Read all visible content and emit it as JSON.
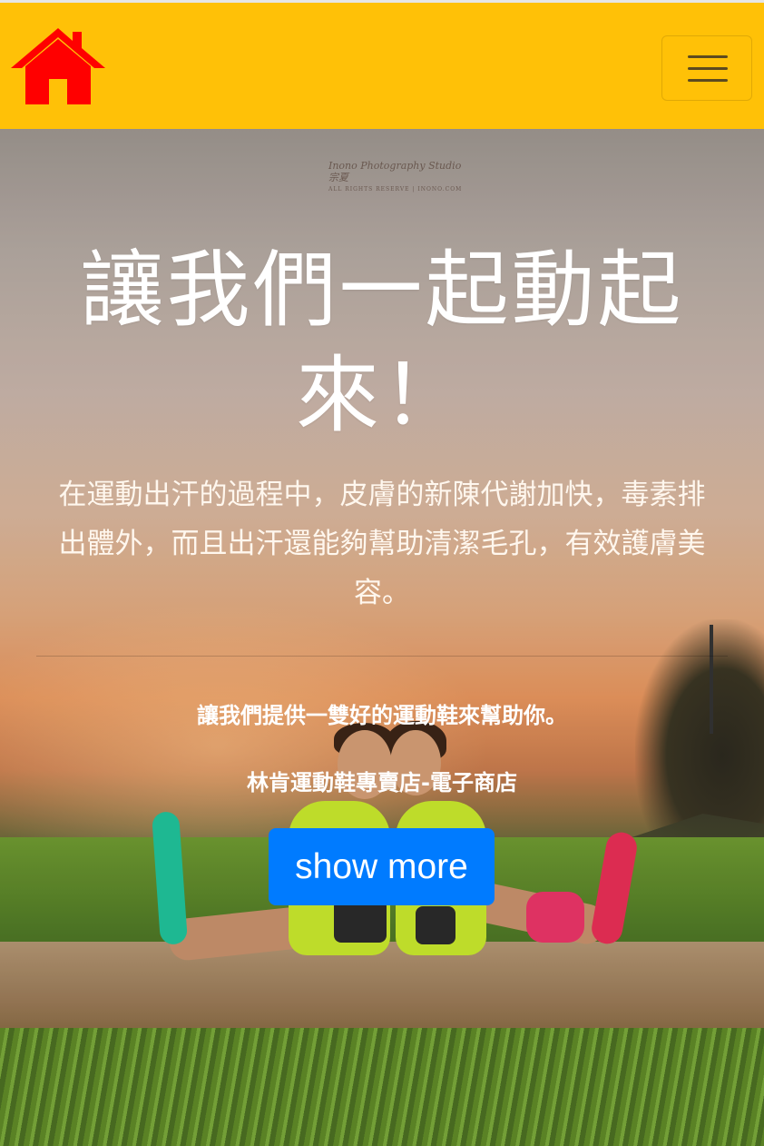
{
  "navbar": {
    "home_icon": "home-icon",
    "toggler_icon": "hamburger-menu-icon",
    "colors": {
      "background": "#ffc107",
      "home_icon": "#ff0000"
    }
  },
  "hero": {
    "watermark_title": "Inono Photography Studio 宗夏",
    "watermark_sub": "ALL RIGHTS RESERVE | INONO.COM",
    "headline": "讓我們一起動起來！",
    "lead": "在運動出汗的過程中，皮膚的新陳代謝加快，毒素排出體外，而且出汗還能夠幫助清潔毛孔，有效護膚美容。",
    "tagline_1": "讓我們提供一雙好的運動鞋來幫助你。",
    "tagline_2": "林肯運動鞋專賣店-電子商店",
    "cta_label": "show more",
    "colors": {
      "button": "#007bff",
      "text": "#ffffff"
    }
  }
}
